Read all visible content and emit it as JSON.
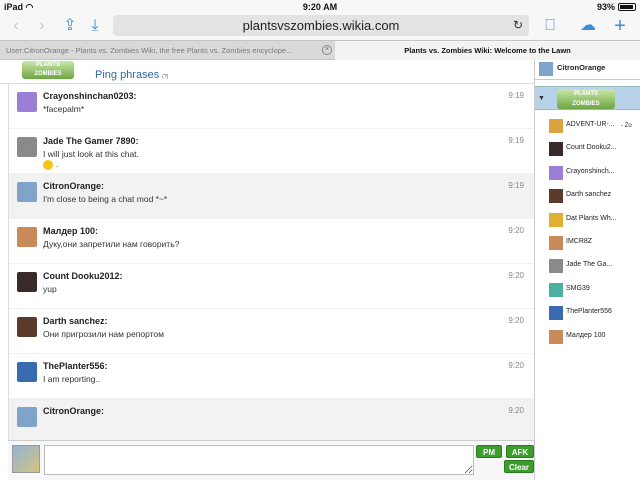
{
  "status": {
    "device": "iPad",
    "time": "9:20 AM",
    "battery": "93%",
    "battery_level": 0.93
  },
  "browser": {
    "url": "plantsvszombies.wikia.com",
    "tabs": [
      {
        "label": "User:CitronOrange - Plants vs. Zombies Wiki, the free Plants vs. Zombies encyclope...",
        "active": false
      },
      {
        "label": "Plants vs. Zombies Wiki: Welcome to the Lawn",
        "active": true
      }
    ]
  },
  "header": {
    "logo_text": "Plants vs. Zombies Wiki",
    "ping_label": "Ping phrases",
    "ping_count": "(?)"
  },
  "messages": [
    {
      "author": "Crayonshinchan0203:",
      "text": "*facepalm*",
      "time": "9:19",
      "own": false,
      "avatar_color": "#9b7fd6"
    },
    {
      "author": "Jade The Gamer 7890:",
      "text": "I will just look at this chat.",
      "time": "9:19",
      "own": false,
      "emoticon_line": ".",
      "avatar_color": "#8a8a8a"
    },
    {
      "author": "CitronOrange:",
      "text": "I'm close to being a chat mod *~*",
      "time": "9:19",
      "own": true,
      "avatar_color": "#7fa3c9"
    },
    {
      "author": "Малдер 100:",
      "text": "Дуку,они запретили нам говорить?",
      "time": "9:20",
      "own": false,
      "avatar_color": "#c98a5a"
    },
    {
      "author": "Count Dooku2012:",
      "text": "yup",
      "time": "9:20",
      "own": false,
      "avatar_color": "#3a2a2a"
    },
    {
      "author": "Darth sanchez:",
      "text": "Они пригрозили нам репортом",
      "time": "9:20",
      "own": false,
      "avatar_color": "#5a3a2a"
    },
    {
      "author": "ThePlanter556:",
      "text": "I am reporting..",
      "time": "9:20",
      "own": false,
      "avatar_color": "#3a6ab0"
    },
    {
      "author": "CitronOrange:",
      "text": "",
      "time": "9:20",
      "own": true,
      "avatar_color": "#7fa3c9"
    }
  ],
  "input": {
    "placeholder": "",
    "pm_label": "PM",
    "afk_label": "AFK",
    "clear_label": "Clear"
  },
  "sidebar": {
    "self_name": "CitronOrange",
    "room_logo_text": "Plants vs. Zombies Wiki",
    "users": [
      {
        "name": "ADVENT-UR-...",
        "extra": "- Zo",
        "color": "#d9a441"
      },
      {
        "name": "Count Dooku2...",
        "extra": "",
        "color": "#3a2a2a"
      },
      {
        "name": "Crayonshinch...",
        "extra": "",
        "color": "#9b7fd6"
      },
      {
        "name": "Darth sanchez",
        "extra": "",
        "color": "#5a3a2a"
      },
      {
        "name": "Dat Plants Wh...",
        "extra": "",
        "color": "#e0b030"
      },
      {
        "name": "IMCR8Z",
        "extra": "",
        "color": "#c98a5a"
      },
      {
        "name": "Jade The Ga...",
        "extra": "",
        "color": "#8a8a8a"
      },
      {
        "name": "SMG39",
        "extra": "",
        "color": "#4ab0a0"
      },
      {
        "name": "ThePlanter556",
        "extra": "",
        "color": "#3a6ab0"
      },
      {
        "name": "Малдер 100",
        "extra": "",
        "color": "#c98a5a"
      }
    ]
  }
}
